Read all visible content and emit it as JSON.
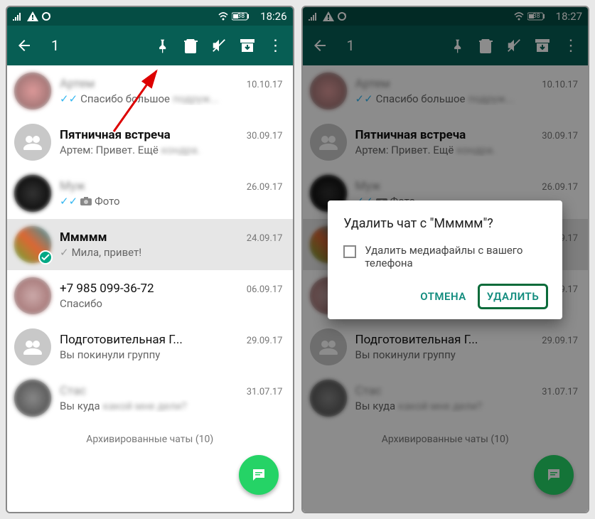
{
  "left": {
    "statusbar": {
      "time": "18:26",
      "battery_text": "38"
    },
    "toolbar": {
      "selected_count": "1"
    },
    "chats": [
      {
        "name": "Артем",
        "name_blur": true,
        "date": "10.10.17",
        "msg_prefix_ticks": "✓✓",
        "msg": "Спасибо большое",
        "msg_blur_tail": "подруж...",
        "avatar_type": "photo"
      },
      {
        "name": "Пятничная встреча",
        "name_bold": true,
        "date": "30.09.17",
        "msg": "Артем: Привет. Ещё",
        "msg_blur_tail": "кондра.",
        "avatar_type": "group"
      },
      {
        "name": "Муж",
        "name_blur": true,
        "date": "26.09.17",
        "msg_prefix_ticks": "✓✓",
        "msg_camera": true,
        "msg": "Фото",
        "avatar_type": "photo"
      },
      {
        "name": "Ммммм",
        "name_bold": true,
        "date": "24.09.17",
        "msg_prefix_tick_gray": "✓",
        "msg": "Мила, привет!",
        "avatar_type": "photo",
        "selected": true
      },
      {
        "name": "+7",
        "name_blur_tail": "985 099-36-72",
        "date": "06.09.17",
        "msg": "Спасибо",
        "avatar_type": "photo"
      },
      {
        "name": "",
        "name_blur_tail": "Подготовительная Г...",
        "date": "29.09.17",
        "msg": "Вы покинули группу",
        "avatar_type": "group"
      },
      {
        "name": "Стас",
        "name_blur": true,
        "date": "31.07.17",
        "msg": "Вы куда",
        "msg_blur_tail": "какой мне дели?",
        "avatar_type": "photo"
      }
    ],
    "archived": "Архивированные чаты (10)"
  },
  "right": {
    "statusbar": {
      "time": "18:27",
      "battery_text": "38"
    },
    "toolbar": {
      "selected_count": "1"
    },
    "dialog": {
      "title": "Удалить чат с \"Ммммм\"?",
      "checkbox_label": "Удалить медиафайлы с вашего телефона",
      "cancel": "ОТМЕНА",
      "confirm": "УДАЛИТЬ"
    },
    "archived": "Архивированные чаты (10)"
  },
  "icons": {
    "back": "←",
    "pin": "pin",
    "delete": "delete",
    "mute": "mute",
    "archive": "archive",
    "more": "⋮",
    "signal": "signal",
    "warning": "⚠",
    "sync": "↻",
    "wifi": "wifi",
    "battery": "battery"
  }
}
